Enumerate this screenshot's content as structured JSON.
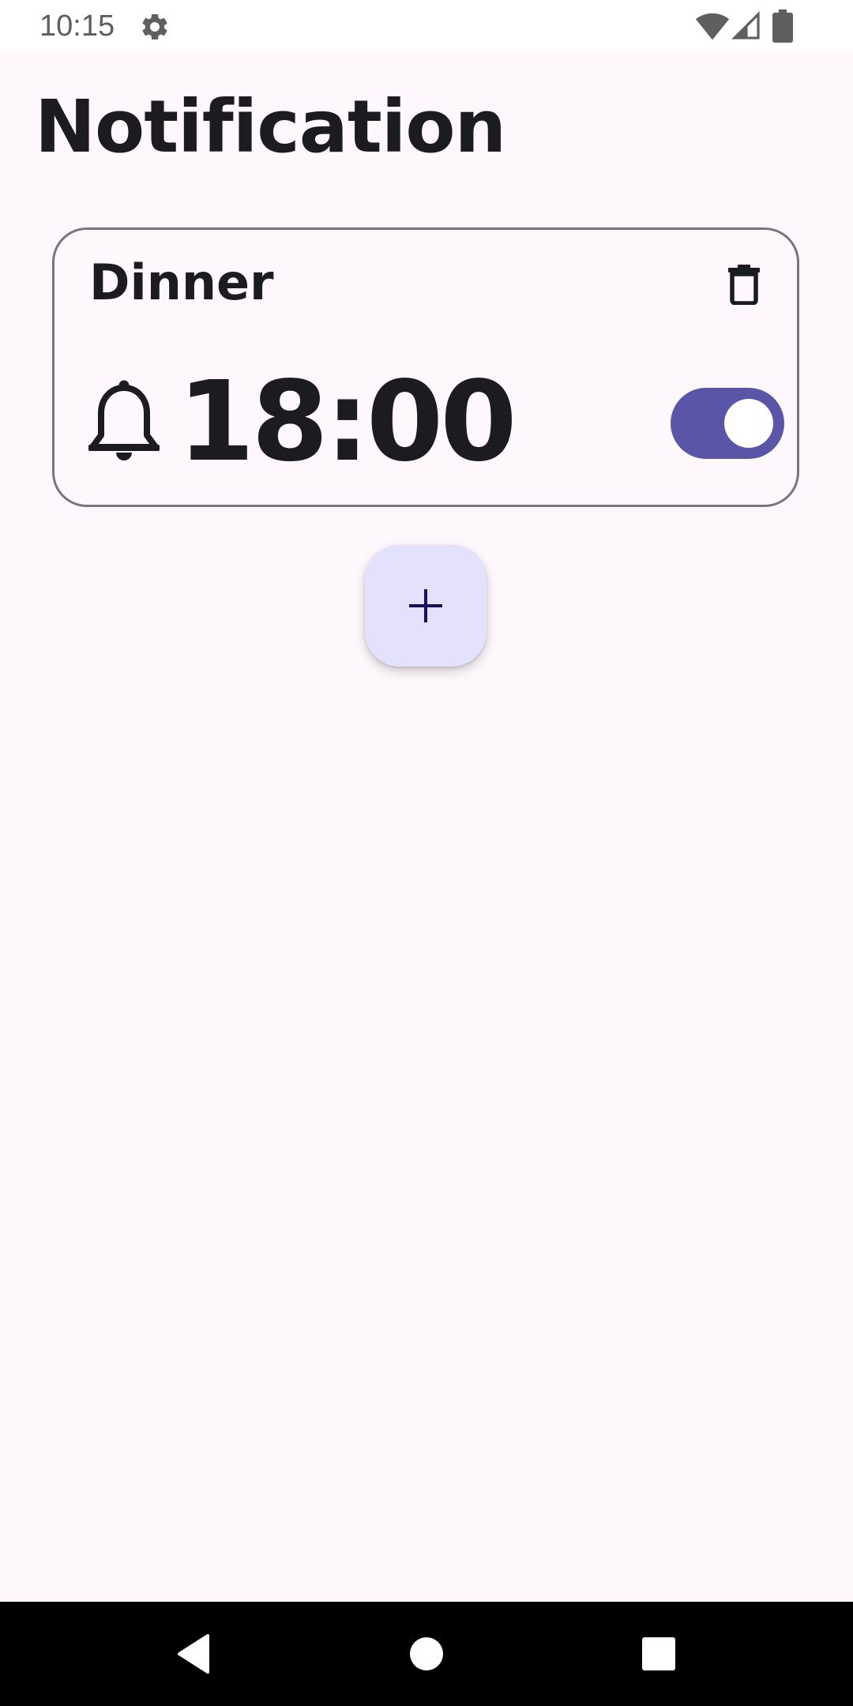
{
  "status_bar": {
    "time": "10:15",
    "icons": [
      "gear-icon",
      "wifi-icon",
      "signal-icon",
      "battery-icon"
    ]
  },
  "page": {
    "title": "Notification"
  },
  "notifications": [
    {
      "title": "Dinner",
      "time": "18:00",
      "enabled": true,
      "icons": {
        "bell": "bell-icon",
        "delete": "trash-icon"
      }
    }
  ],
  "fab": {
    "icon": "plus-icon"
  },
  "nav_bar": {
    "buttons": [
      "back-icon",
      "home-icon",
      "recents-icon"
    ]
  },
  "colors": {
    "background": "#FEF7FB",
    "accent": "#5B55A8",
    "fab_background": "#E4E1FC",
    "card_border": "#79747E",
    "text": "#1C1B1F"
  }
}
